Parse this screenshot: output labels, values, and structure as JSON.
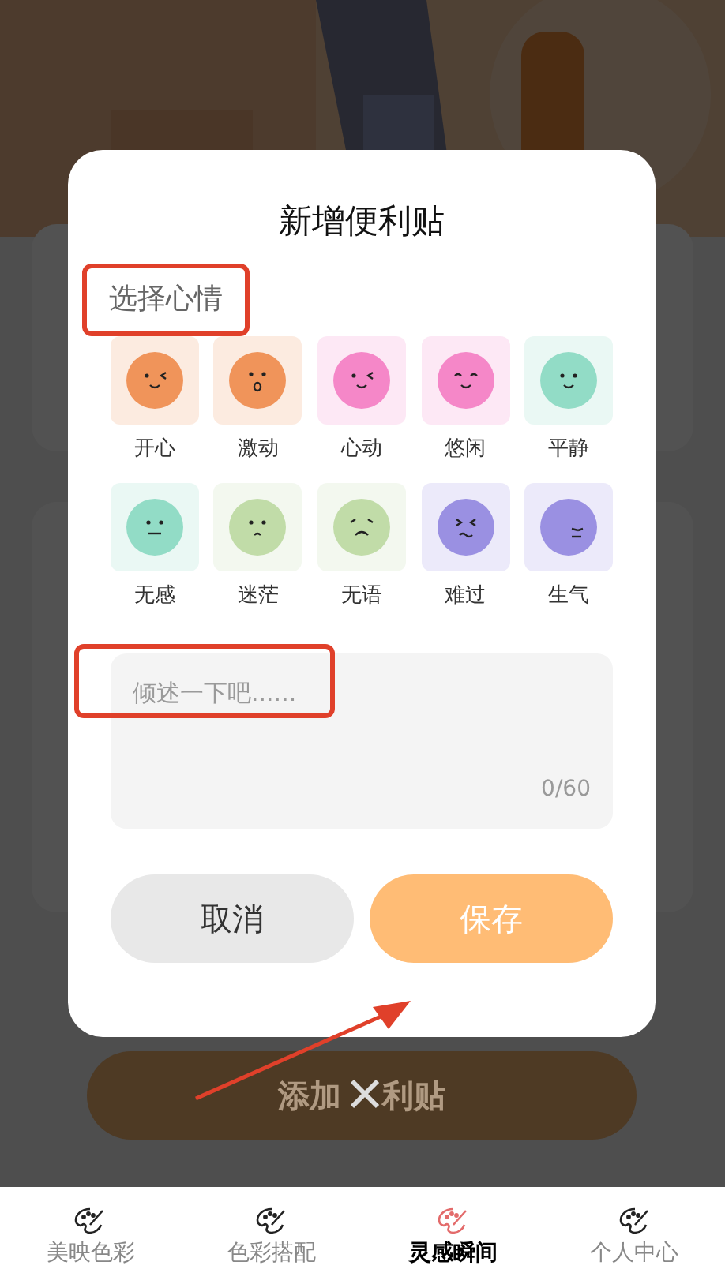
{
  "background": {
    "add_button": {
      "before": "添加",
      "after": "利贴"
    }
  },
  "dialog": {
    "title": "新增便利贴",
    "mood_label": "选择心情",
    "moods": [
      {
        "label": "开心",
        "kind": "wink",
        "color": "#f0945a"
      },
      {
        "label": "激动",
        "kind": "surprised",
        "color": "#f0945a"
      },
      {
        "label": "心动",
        "kind": "wink",
        "color": "#f587c8"
      },
      {
        "label": "悠闲",
        "kind": "relaxed",
        "color": "#f587c8"
      },
      {
        "label": "平静",
        "kind": "smile",
        "color": "#92dcc6"
      },
      {
        "label": "无感",
        "kind": "neutral",
        "color": "#92dcc6"
      },
      {
        "label": "迷茫",
        "kind": "frown",
        "color": "#c1dca8"
      },
      {
        "label": "无语",
        "kind": "speechless",
        "color": "#c1dca8"
      },
      {
        "label": "难过",
        "kind": "sad",
        "color": "#9a90e2"
      },
      {
        "label": "生气",
        "kind": "angry",
        "color": "#9a90e2"
      }
    ],
    "note": {
      "placeholder": "倾述一下吧......",
      "counter": "0/60"
    },
    "buttons": [
      {
        "label": "取消",
        "kind": "secondary"
      },
      {
        "label": "保存",
        "kind": "primary"
      }
    ]
  },
  "tab_bar": [
    {
      "label": "美映色彩",
      "selected": false
    },
    {
      "label": "色彩搭配",
      "selected": false
    },
    {
      "label": "灵感瞬间",
      "selected": true
    },
    {
      "label": "个人中心",
      "selected": false
    }
  ]
}
